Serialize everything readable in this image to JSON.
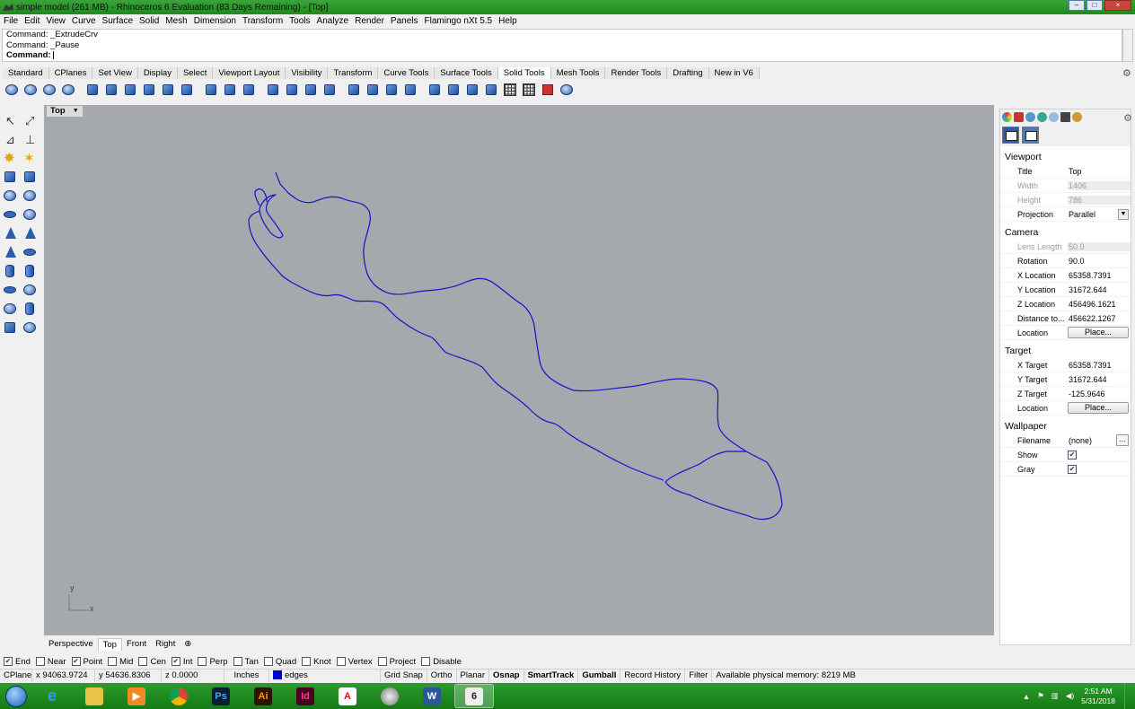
{
  "window": {
    "title": "simple model (261 MB) - Rhinoceros 6 Evaluation (83 Days Remaining) - [Top]",
    "minimize": "–",
    "maximize": "□",
    "close": "×"
  },
  "menu": [
    "File",
    "Edit",
    "View",
    "Curve",
    "Surface",
    "Solid",
    "Mesh",
    "Dimension",
    "Transform",
    "Tools",
    "Analyze",
    "Render",
    "Panels",
    "Flamingo nXt 5.5",
    "Help"
  ],
  "command_history": [
    "Command: _ExtrudeCrv",
    "Command: _Pause"
  ],
  "command_prompt": "Command:",
  "toolbar_tabs": [
    "Standard",
    "CPlanes",
    "Set View",
    "Display",
    "Select",
    "Viewport Layout",
    "Visibility",
    "Transform",
    "Curve Tools",
    "Surface Tools",
    "Solid Tools",
    "Mesh Tools",
    "Render Tools",
    "Drafting",
    "New in V6"
  ],
  "active_toolbar_tab": "Solid Tools",
  "viewport": {
    "title": "Top",
    "axis_y": "y",
    "axis_x": "x",
    "curve_color": "#1414c8",
    "background": "#a5a8ad"
  },
  "viewport_tabs": [
    "Perspective",
    "Top",
    "Front",
    "Right"
  ],
  "viewport_tabs_add": "⊕",
  "osnaps": [
    {
      "label": "End",
      "checked": true
    },
    {
      "label": "Near",
      "checked": false
    },
    {
      "label": "Point",
      "checked": true
    },
    {
      "label": "Mid",
      "checked": false
    },
    {
      "label": "Cen",
      "checked": false
    },
    {
      "label": "Int",
      "checked": true
    },
    {
      "label": "Perp",
      "checked": false
    },
    {
      "label": "Tan",
      "checked": false
    },
    {
      "label": "Quad",
      "checked": false
    },
    {
      "label": "Knot",
      "checked": false
    },
    {
      "label": "Vertex",
      "checked": false
    },
    {
      "label": "Project",
      "checked": false
    },
    {
      "label": "Disable",
      "checked": false
    }
  ],
  "status": {
    "cplane": "CPlane",
    "x": "x 94063.9724",
    "y": "y 54636.8306",
    "z": "z 0.0000",
    "units": "Inches",
    "layer": "edges",
    "layer_color": "#0000c8",
    "grid_snap": "Grid Snap",
    "ortho": "Ortho",
    "planar": "Planar",
    "osnap": "Osnap",
    "smarttrack": "SmartTrack",
    "gumball": "Gumball",
    "record_history": "Record History",
    "filter": "Filter",
    "memory": "Available physical memory: 8219 MB"
  },
  "panel": {
    "viewport_header": "Viewport",
    "viewport_rows": [
      {
        "label": "Title",
        "value": "Top",
        "disabled": false
      },
      {
        "label": "Width",
        "value": "1406",
        "disabled": true
      },
      {
        "label": "Height",
        "value": "786",
        "disabled": true
      },
      {
        "label": "Projection",
        "value": "Parallel",
        "disabled": false
      }
    ],
    "camera_header": "Camera",
    "camera_rows": [
      {
        "label": "Lens Length",
        "value": "50.0",
        "disabled": true
      },
      {
        "label": "Rotation",
        "value": "90.0",
        "disabled": false
      },
      {
        "label": "X Location",
        "value": "65358.7391",
        "disabled": false
      },
      {
        "label": "Y Location",
        "value": "31672.644",
        "disabled": false
      },
      {
        "label": "Z Location",
        "value": "456496.1621",
        "disabled": false
      },
      {
        "label": "Distance to...",
        "value": "456622.1267",
        "disabled": false
      }
    ],
    "camera_location_label": "Location",
    "place_button": "Place...",
    "target_header": "Target",
    "target_rows": [
      {
        "label": "X Target",
        "value": "65358.7391"
      },
      {
        "label": "Y Target",
        "value": "31672.644"
      },
      {
        "label": "Z Target",
        "value": "-125.9646"
      }
    ],
    "target_location_label": "Location",
    "wallpaper_header": "Wallpaper",
    "filename_label": "Filename",
    "filename_value": "(none)",
    "browse_button": "...",
    "show_label": "Show",
    "show_checked": true,
    "gray_label": "Gray",
    "gray_checked": true
  },
  "taskbar": {
    "apps": [
      "Internet Explorer",
      "File Explorer",
      "Media Player",
      "Chrome",
      "Photoshop",
      "Illustrator",
      "InDesign",
      "Acrobat",
      "Rhino Render",
      "Word",
      "Rhinoceros"
    ],
    "ps_label": "Ps",
    "ai_label": "Ai",
    "id_label": "Id",
    "word_label": "W",
    "time": "2:51 AM",
    "date": "5/31/2018"
  }
}
